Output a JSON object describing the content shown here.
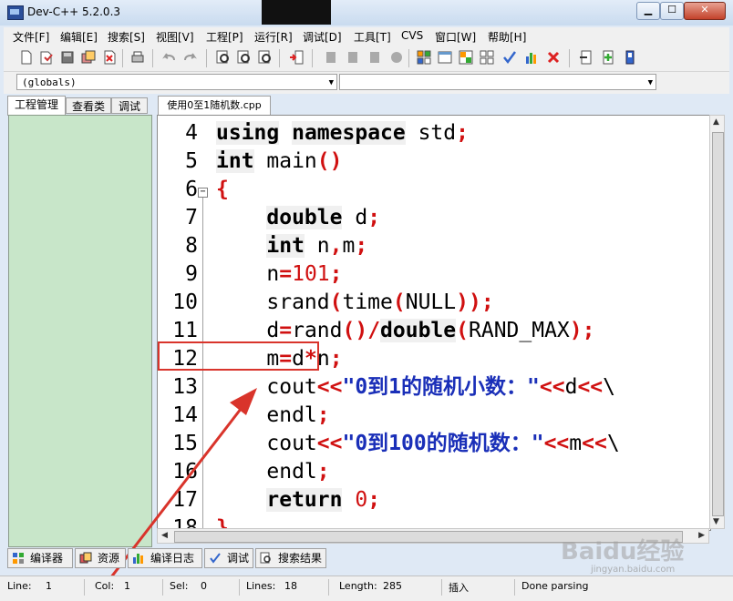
{
  "window": {
    "title": "Dev-C++ 5.2.0.3"
  },
  "menu": [
    "文件[F]",
    "编辑[E]",
    "搜索[S]",
    "视图[V]",
    "工程[P]",
    "运行[R]",
    "调试[D]",
    "工具[T]",
    "CVS",
    "窗口[W]",
    "帮助[H]"
  ],
  "combos": {
    "scope": "(globals)",
    "function": ""
  },
  "left_tabs": [
    "工程管理",
    "查看类",
    "调试"
  ],
  "editor": {
    "file_tab": "使用0至1随机数.cpp",
    "lines": [
      {
        "n": "4",
        "parts": [
          {
            "t": "using",
            "c": "kw"
          },
          {
            "t": " ",
            "c": "plain"
          },
          {
            "t": "namespace",
            "c": "kw"
          },
          {
            "t": " std",
            "c": "plain"
          },
          {
            "t": ";",
            "c": "sym"
          }
        ]
      },
      {
        "n": "5",
        "parts": [
          {
            "t": "int",
            "c": "kw"
          },
          {
            "t": " main",
            "c": "plain"
          },
          {
            "t": "()",
            "c": "sym"
          }
        ]
      },
      {
        "n": "6",
        "parts": [
          {
            "t": "{",
            "c": "sym"
          }
        ]
      },
      {
        "n": "7",
        "parts": [
          {
            "t": "    ",
            "c": "plain"
          },
          {
            "t": "double",
            "c": "kw"
          },
          {
            "t": " d",
            "c": "plain"
          },
          {
            "t": ";",
            "c": "sym"
          }
        ]
      },
      {
        "n": "8",
        "parts": [
          {
            "t": "    ",
            "c": "plain"
          },
          {
            "t": "int",
            "c": "kw"
          },
          {
            "t": " n",
            "c": "plain"
          },
          {
            "t": ",",
            "c": "sym"
          },
          {
            "t": "m",
            "c": "plain"
          },
          {
            "t": ";",
            "c": "sym"
          }
        ]
      },
      {
        "n": "9",
        "parts": [
          {
            "t": "    n",
            "c": "plain"
          },
          {
            "t": "=",
            "c": "sym"
          },
          {
            "t": "101",
            "c": "num"
          },
          {
            "t": ";",
            "c": "sym"
          }
        ]
      },
      {
        "n": "10",
        "parts": [
          {
            "t": "    srand",
            "c": "plain"
          },
          {
            "t": "(",
            "c": "sym"
          },
          {
            "t": "time",
            "c": "plain"
          },
          {
            "t": "(",
            "c": "sym"
          },
          {
            "t": "NULL",
            "c": "plain"
          },
          {
            "t": "));",
            "c": "sym"
          }
        ]
      },
      {
        "n": "11",
        "parts": [
          {
            "t": "    d",
            "c": "plain"
          },
          {
            "t": "=",
            "c": "sym"
          },
          {
            "t": "rand",
            "c": "plain"
          },
          {
            "t": "()/",
            "c": "sym"
          },
          {
            "t": "double",
            "c": "kw"
          },
          {
            "t": "(",
            "c": "sym"
          },
          {
            "t": "RAND_MAX",
            "c": "plain"
          },
          {
            "t": ");",
            "c": "sym"
          }
        ]
      },
      {
        "n": "12",
        "parts": [
          {
            "t": "    m",
            "c": "plain"
          },
          {
            "t": "=",
            "c": "sym"
          },
          {
            "t": "d",
            "c": "plain"
          },
          {
            "t": "*",
            "c": "sym"
          },
          {
            "t": "n",
            "c": "plain"
          },
          {
            "t": ";",
            "c": "sym"
          }
        ]
      },
      {
        "n": "13",
        "parts": [
          {
            "t": "    cout",
            "c": "plain"
          },
          {
            "t": "<<",
            "c": "sym"
          },
          {
            "t": "\"0到1的随机小数：\"",
            "c": "str"
          },
          {
            "t": "<<",
            "c": "sym"
          },
          {
            "t": "d",
            "c": "plain"
          },
          {
            "t": "<<",
            "c": "sym"
          },
          {
            "t": "\\",
            "c": "plain"
          }
        ]
      },
      {
        "n": "14",
        "parts": [
          {
            "t": "    endl",
            "c": "plain"
          },
          {
            "t": ";",
            "c": "sym"
          }
        ]
      },
      {
        "n": "15",
        "parts": [
          {
            "t": "    cout",
            "c": "plain"
          },
          {
            "t": "<<",
            "c": "sym"
          },
          {
            "t": "\"0到100的随机数：\"",
            "c": "str"
          },
          {
            "t": "<<",
            "c": "sym"
          },
          {
            "t": "m",
            "c": "plain"
          },
          {
            "t": "<<",
            "c": "sym"
          },
          {
            "t": "\\",
            "c": "plain"
          }
        ]
      },
      {
        "n": "16",
        "parts": [
          {
            "t": "    endl",
            "c": "plain"
          },
          {
            "t": ";",
            "c": "sym"
          }
        ]
      },
      {
        "n": "17",
        "parts": [
          {
            "t": "    ",
            "c": "plain"
          },
          {
            "t": "return",
            "c": "kw"
          },
          {
            "t": " ",
            "c": "plain"
          },
          {
            "t": "0",
            "c": "num"
          },
          {
            "t": ";",
            "c": "sym"
          }
        ]
      },
      {
        "n": "18",
        "parts": [
          {
            "t": "}",
            "c": "sym"
          }
        ]
      }
    ]
  },
  "bottom_tabs": [
    "编译器",
    "资源",
    "编译日志",
    "调试",
    "搜索结果"
  ],
  "status": {
    "line_label": "Line:",
    "line": "1",
    "col_label": "Col:",
    "col": "1",
    "sel_label": "Sel:",
    "sel": "0",
    "lines_label": "Lines:",
    "lines": "18",
    "length_label": "Length:",
    "length": "285",
    "mode": "插入",
    "message": "Done parsing"
  },
  "watermark": {
    "brand": "Baidu经验",
    "sub": "jingyan.baidu.com"
  },
  "colors": {
    "keyword": "#000000",
    "symbol": "#d01010",
    "string": "#1a2fb8",
    "annotation": "#d9342b",
    "panel": "#c8e6c9"
  }
}
